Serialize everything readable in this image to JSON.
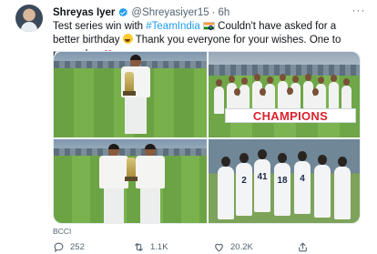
{
  "tweet": {
    "author_name": "Shreyas Iyer",
    "handle": "@Shreyasiyer15",
    "separator": "·",
    "time": "6h",
    "more_glyph": "···",
    "text_part1": "Test series win with ",
    "hashtag": "#TeamIndia",
    "text_part2": " Couldn't have asked for a better birthday ",
    "text_part3": " Thank you everyone for your wishes. One to remember ",
    "banner_text": "CHAMPIONS",
    "jersey_numbers": [
      "2",
      "41",
      "18",
      "4"
    ],
    "media_credit": "BCCI",
    "replies": "252",
    "retweets": "1.1K",
    "likes": "20.2K"
  },
  "icons": {
    "verified": "verified-badge-icon",
    "flag": "india-flag-emoji-icon",
    "grin": "grinning-emoji-icon",
    "heart": "red-heart-emoji-icon",
    "reply": "reply-icon",
    "retweet": "retweet-icon",
    "like": "like-icon",
    "share": "share-icon"
  },
  "colors": {
    "link": "#1d9bf0",
    "secondary_text": "#536471",
    "primary_text": "#0f1419",
    "banner_red": "#d9232d"
  }
}
